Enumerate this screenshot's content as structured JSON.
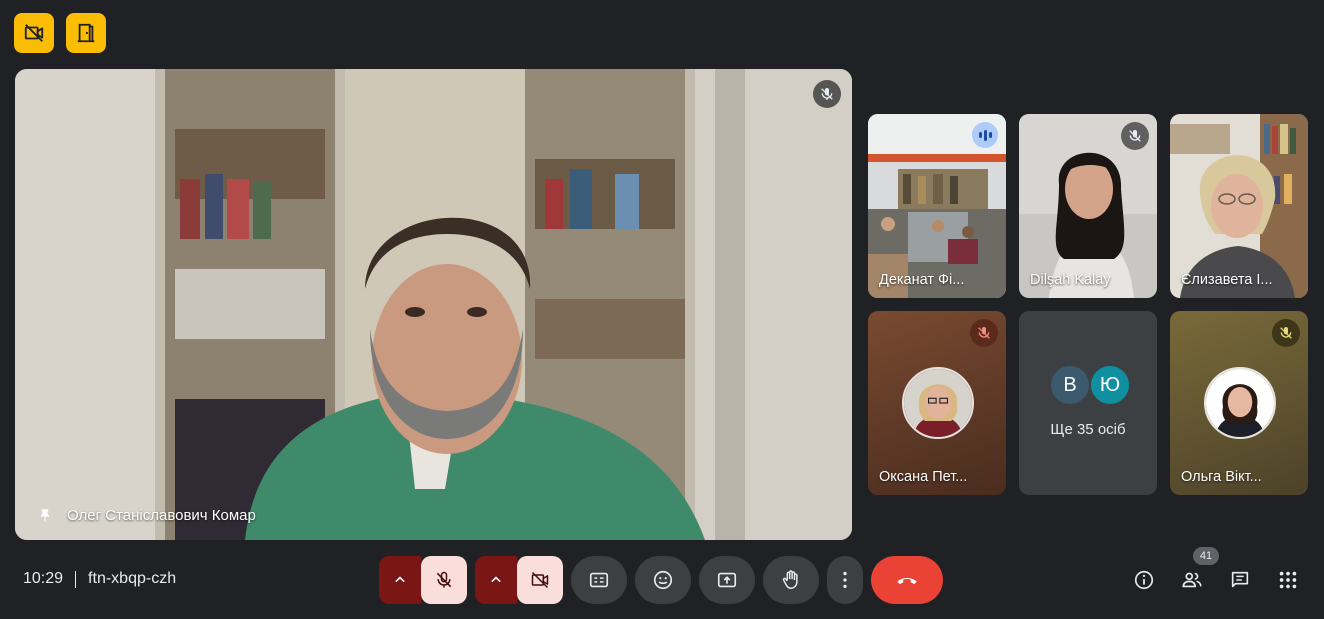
{
  "top_badges": [
    {
      "name": "no-video-badge",
      "icon": "video-off-icon",
      "color": "#fbbc04"
    },
    {
      "name": "door-badge",
      "icon": "door-icon",
      "color": "#fbbc04"
    }
  ],
  "main_participant": {
    "name": "Олег Станіславович Комар",
    "muted": true,
    "pinned": true
  },
  "tiles": [
    {
      "name": "Деканат Фі...",
      "speaking": true,
      "active": true
    },
    {
      "name": "Dilşah Kalay",
      "muted": true
    },
    {
      "name": "Єлизавета І...",
      "muted": false
    },
    {
      "name": "Оксана Пет...",
      "muted": true
    },
    {
      "name": "Ще 35 осіб",
      "avatars": [
        "В",
        "Ю"
      ],
      "avatar_colors": [
        "#3c5a6e",
        "#0f8fa0"
      ]
    },
    {
      "name": "Ольга Вікт...",
      "muted": true
    }
  ],
  "meeting": {
    "time": "10:29",
    "code": "ftn-xbqp-czh"
  },
  "controls": {
    "mic_state": "off",
    "camera_state": "off",
    "buttons": [
      "captions-icon",
      "emoji-icon",
      "present-icon",
      "raise-hand-icon",
      "more-options-icon"
    ],
    "end_call_color": "#ea4335"
  },
  "right_panel": {
    "participant_count": "41",
    "icons": [
      "info-icon",
      "people-icon",
      "chat-icon",
      "activities-icon"
    ]
  },
  "colors": {
    "background": "#202124",
    "accent_badge": "#fbbc04",
    "active_outline": "#aecbfa",
    "toggle_off_bg": "#f9dedc",
    "toggle_caret_bg": "#7a1613"
  }
}
